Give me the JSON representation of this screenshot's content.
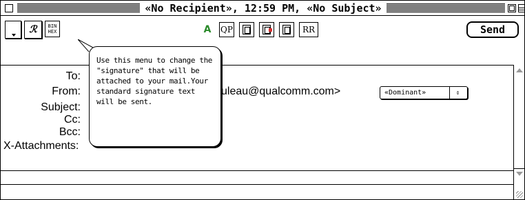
{
  "window": {
    "title": "«No Recipient», 12:59 PM, «No Subject»"
  },
  "toolbar": {
    "binhex_label_top": "BIN",
    "binhex_label_bottom": "HEX",
    "signature_label": "ℛ",
    "text_icon": "A",
    "qp_label": "QP",
    "rr_label": "RR",
    "send_label": "Send",
    "icons": {
      "signature": "signature-menu-icon",
      "text": "text-style-icon",
      "b1": "document-icon",
      "b2": "document-send-icon",
      "b3": "document-copy-icon"
    }
  },
  "headers": {
    "to_label": "To:",
    "from_label": "From:",
    "from_value": "uleau@qualcomm.com>",
    "subject_label": "Subject:",
    "cc_label": "Cc:",
    "bcc_label": "Bcc:",
    "attachments_label": "X-Attachments:",
    "personality_value": "«Dominant»",
    "personality_arrows": "⇕"
  },
  "balloon": {
    "text": "Use this menu to change the \"signature\" that will be attached to your mail.Your standard signature text will be sent."
  },
  "colors": {
    "text_icon_green": "#2a8a2a",
    "accent_red": "#dd3333"
  }
}
